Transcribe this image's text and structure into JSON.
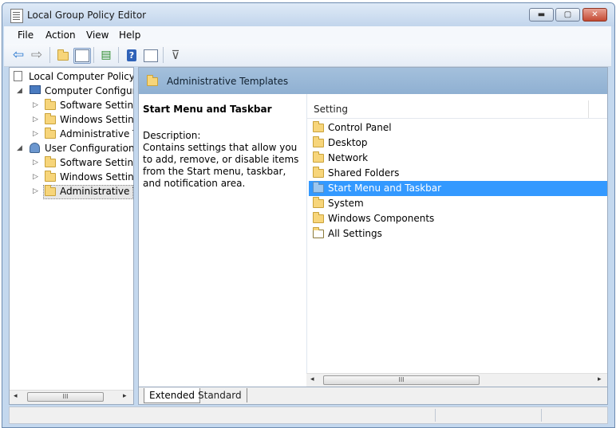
{
  "window": {
    "title": "Local Group Policy Editor",
    "min_glyph": "▬",
    "max_glyph": "▢",
    "close_glyph": "✕"
  },
  "menu": {
    "items": [
      "File",
      "Action",
      "View",
      "Help"
    ]
  },
  "toolbar": {
    "back_glyph": "⇦",
    "forward_glyph": "⇨",
    "help_glyph": "?",
    "filter_glyph": "⊽"
  },
  "tree": {
    "root": "Local Computer Policy",
    "computer_configuration": "Computer Configura",
    "computer_children": [
      "Software Settings",
      "Windows Setting",
      "Administrative Te"
    ],
    "user_configuration": "User Configuration",
    "user_children": [
      "Software Settings",
      "Windows Setting",
      "Administrative Te"
    ],
    "scroll_thumb_glyph": "III",
    "scroll_left_glyph": "◂",
    "scroll_right_glyph": "▸"
  },
  "main": {
    "header_title": "Administrative Templates",
    "description": {
      "title": "Start Menu and Taskbar",
      "label": "Description:",
      "text": "Contains settings that allow you to add, remove, or disable items from the Start menu, taskbar, and notification area."
    },
    "column_header": "Setting",
    "list_items": [
      "Control Panel",
      "Desktop",
      "Network",
      "Shared Folders",
      "Start Menu and Taskbar",
      "System",
      "Windows Components",
      "All Settings"
    ],
    "selected_item": "Start Menu and Taskbar",
    "scroll_thumb_glyph": "III",
    "scroll_left_glyph": "◂",
    "scroll_right_glyph": "▸"
  },
  "tabs": [
    "Extended",
    "Standard"
  ],
  "colors": {
    "selection": "#3399ff",
    "header": "#98b8d8",
    "folder": "#f7d57a"
  }
}
